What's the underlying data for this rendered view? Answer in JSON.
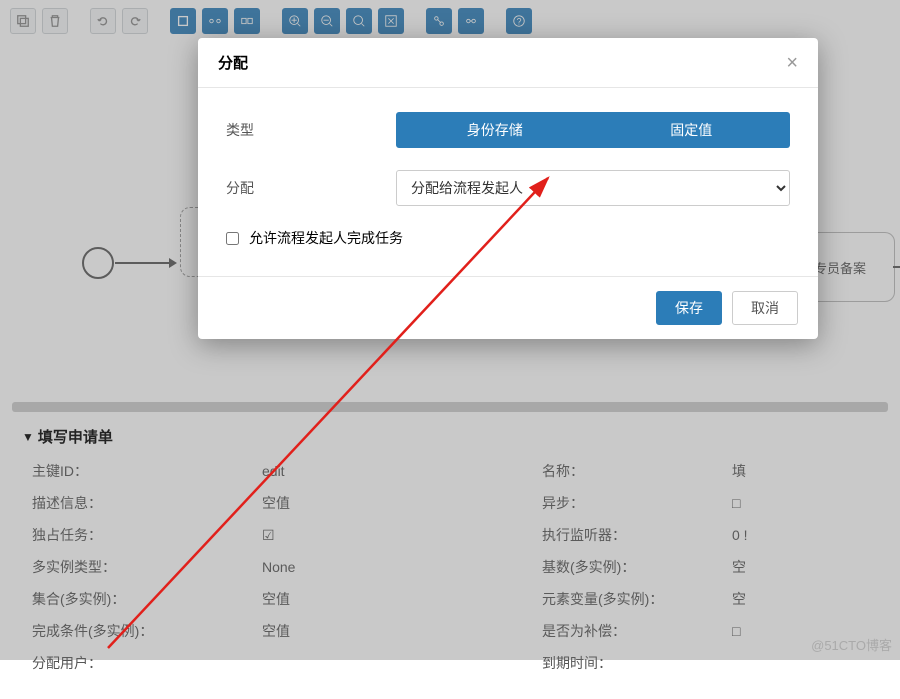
{
  "modal": {
    "title": "分配",
    "type_label": "类型",
    "tab_identity": "身份存储",
    "tab_fixed": "固定值",
    "assign_label": "分配",
    "assign_value": "分配给流程发起人",
    "checkbox_label": "允许流程发起人完成任务",
    "save": "保存",
    "cancel": "取消"
  },
  "canvas": {
    "task_right": "专员备案"
  },
  "props": {
    "section_title": "填写申请单",
    "rows": [
      {
        "l": "主键ID：",
        "v": "edit",
        "l2": "名称：",
        "v2": "填"
      },
      {
        "l": "描述信息：",
        "v": "空值",
        "l2": "异步：",
        "v2": "□"
      },
      {
        "l": "独占任务：",
        "v": "☑",
        "l2": "执行监听器：",
        "v2": "0 !"
      },
      {
        "l": "多实例类型：",
        "v": "None",
        "l2": "基数(多实例)：",
        "v2": "空"
      },
      {
        "l": "集合(多实例)：",
        "v": "空值",
        "l2": "元素变量(多实例)：",
        "v2": "空"
      },
      {
        "l": "完成条件(多实例)：",
        "v": "空值",
        "l2": "是否为补偿：",
        "v2": "□"
      },
      {
        "l": "分配用户：",
        "v": "",
        "l2": "到期时间：",
        "v2": ""
      }
    ]
  },
  "watermark": "@51CTO博客"
}
